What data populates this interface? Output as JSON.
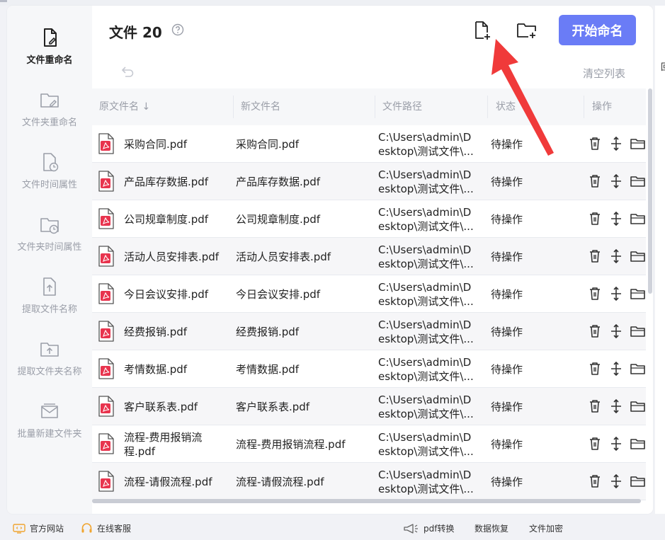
{
  "sidebar": {
    "items": [
      {
        "label": "文件重命名",
        "icon": "file-edit-icon",
        "active": true
      },
      {
        "label": "文件夹重命名",
        "icon": "folder-edit-icon",
        "active": false
      },
      {
        "label": "文件时间属性",
        "icon": "file-clock-icon",
        "active": false
      },
      {
        "label": "文件夹时间属性",
        "icon": "folder-clock-icon",
        "active": false
      },
      {
        "label": "提取文件名称",
        "icon": "file-upload-icon",
        "active": false
      },
      {
        "label": "提取文件夹名称",
        "icon": "folder-upload-icon",
        "active": false
      },
      {
        "label": "批量新建文件夹",
        "icon": "folder-batch-icon",
        "active": false
      }
    ]
  },
  "header": {
    "title": "文件 20",
    "start_label": "开始命名",
    "clear_label": "清空列表"
  },
  "table": {
    "columns": [
      "原文件名 ↓",
      "新文件名",
      "文件路径",
      "状态",
      "操作"
    ],
    "rows": [
      {
        "name": "采购合同.pdf",
        "new_name": "采购合同.pdf",
        "path": "C:\\Users\\admin\\D\nesktop\\测试文件\\...",
        "status": "待操作"
      },
      {
        "name": "产品库存数据.pdf",
        "new_name": "产品库存数据.pdf",
        "path": "C:\\Users\\admin\\D\nesktop\\测试文件\\...",
        "status": "待操作"
      },
      {
        "name": "公司规章制度.pdf",
        "new_name": "公司规章制度.pdf",
        "path": "C:\\Users\\admin\\D\nesktop\\测试文件\\...",
        "status": "待操作"
      },
      {
        "name": "活动人员安排表.pdf",
        "new_name": "活动人员安排表.pdf",
        "path": "C:\\Users\\admin\\D\nesktop\\测试文件\\...",
        "status": "待操作"
      },
      {
        "name": "今日会议安排.pdf",
        "new_name": "今日会议安排.pdf",
        "path": "C:\\Users\\admin\\D\nesktop\\测试文件\\...",
        "status": "待操作"
      },
      {
        "name": "经费报销.pdf",
        "new_name": "经费报销.pdf",
        "path": "C:\\Users\\admin\\D\nesktop\\测试文件\\...",
        "status": "待操作"
      },
      {
        "name": "考情数据.pdf",
        "new_name": "考情数据.pdf",
        "path": "C:\\Users\\admin\\D\nesktop\\测试文件\\...",
        "status": "待操作"
      },
      {
        "name": "客户联系表.pdf",
        "new_name": "客户联系表.pdf",
        "path": "C:\\Users\\admin\\D\nesktop\\测试文件\\...",
        "status": "待操作"
      },
      {
        "name": "流程-费用报销流程.pdf",
        "new_name": "流程-费用报销流程.pdf",
        "path": "C:\\Users\\admin\\D\nesktop\\测试文件\\...",
        "status": "待操作"
      },
      {
        "name": "流程-请假流程.pdf",
        "new_name": "流程-请假流程.pdf",
        "path": "C:\\Users\\admin\\D\nesktop\\测试文件\\...",
        "status": "待操作"
      }
    ]
  },
  "footer": {
    "website": "官方网站",
    "service": "在线客服",
    "pdf": "pdf转换",
    "recovery": "数据恢复",
    "encrypt": "文件加密"
  },
  "right_edge": {
    "label": "回"
  },
  "colors": {
    "accent": "#6a7cf6",
    "pdf_red": "#e8344e",
    "arrow_red": "#f03a3a"
  }
}
